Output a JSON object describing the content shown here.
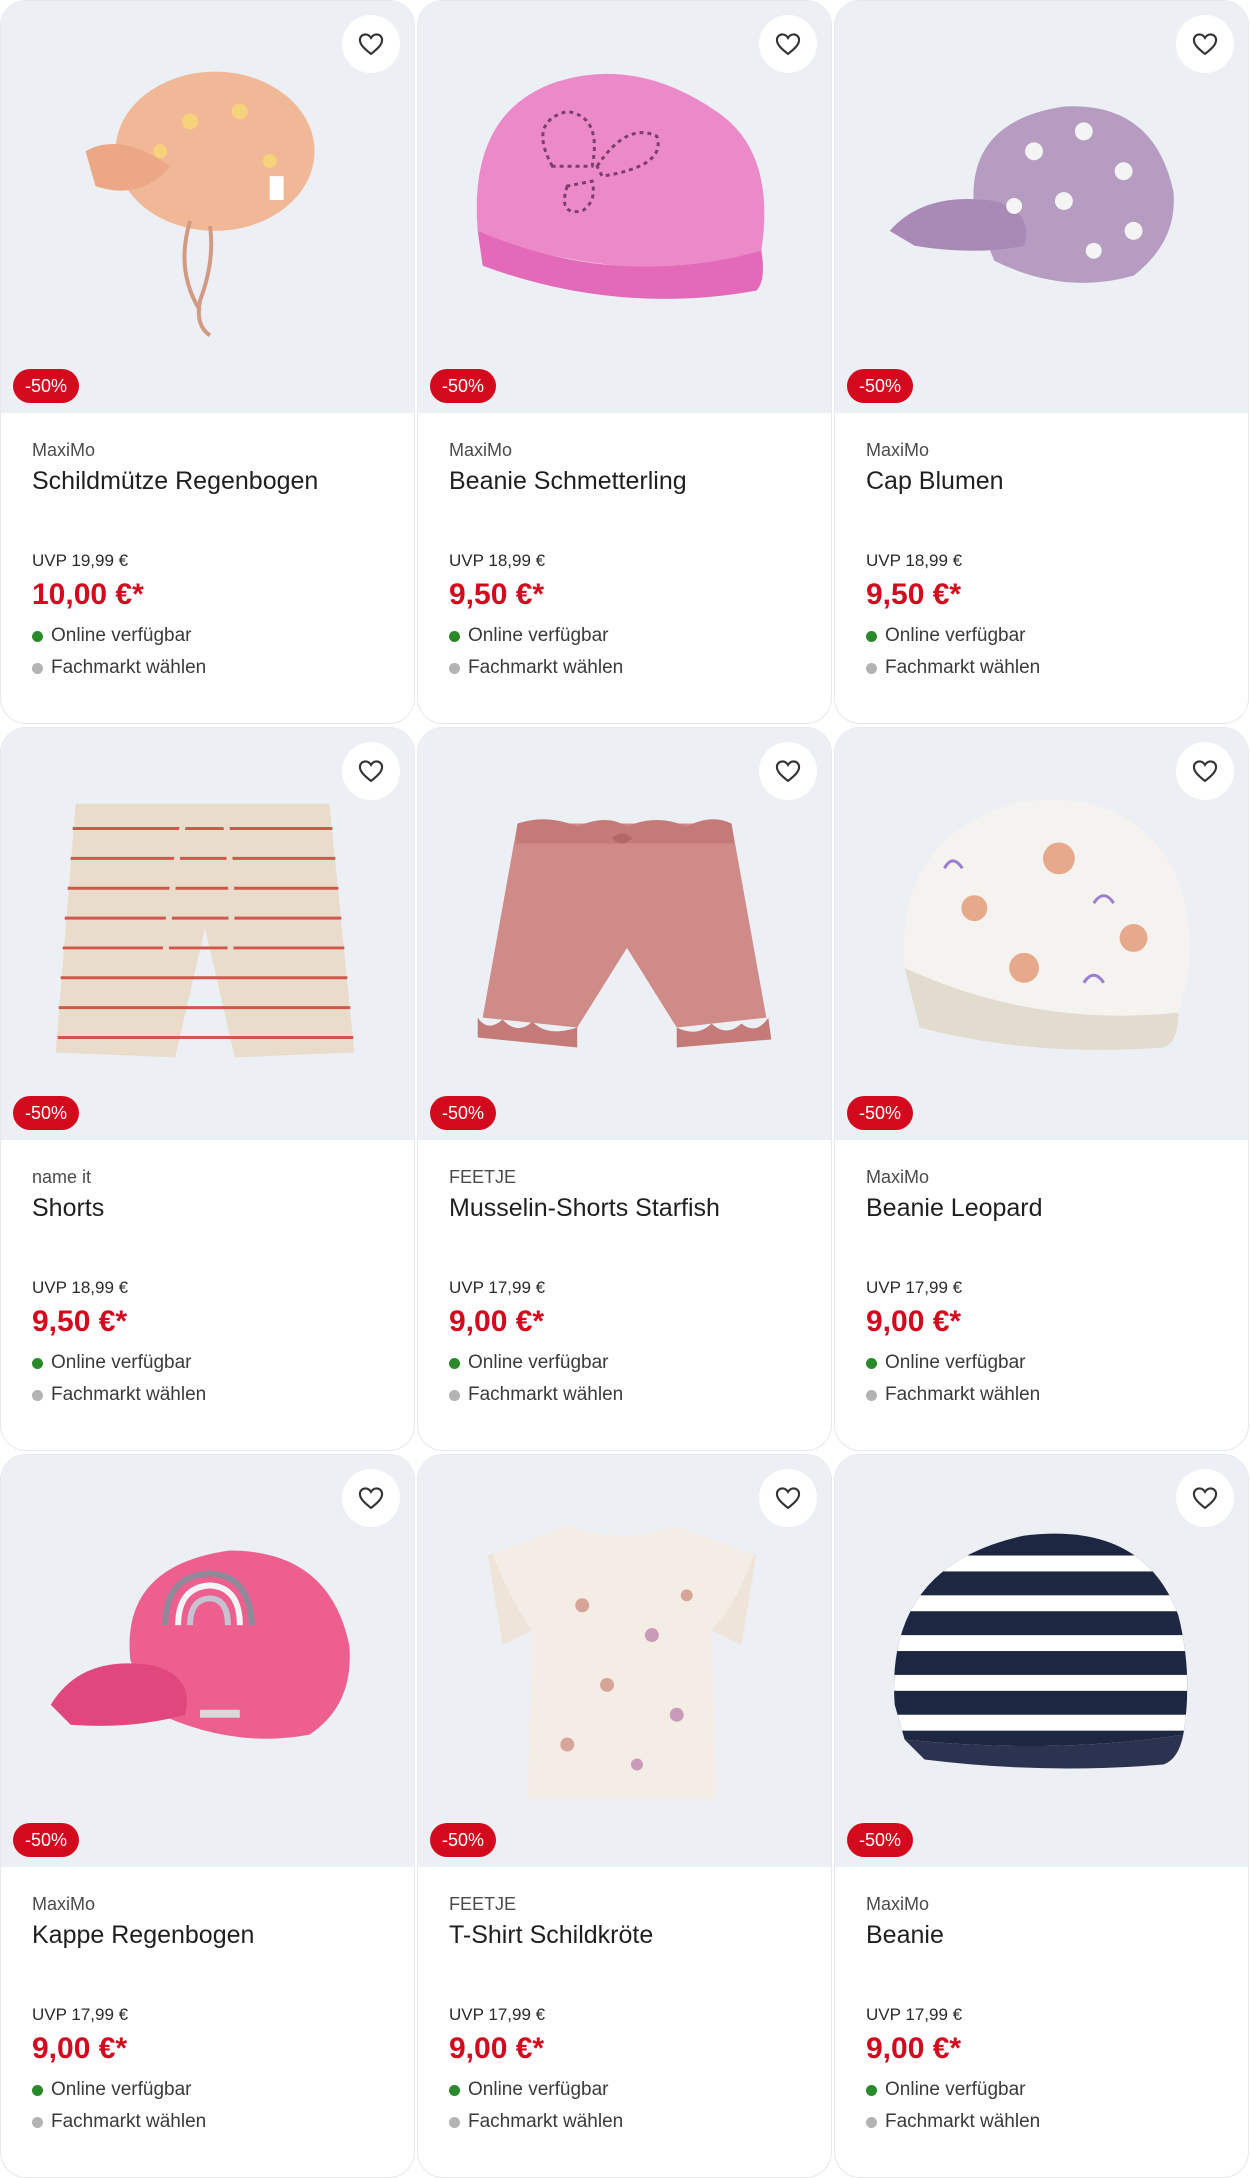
{
  "colors": {
    "badge_bg": "#d3091e",
    "price": "#d3091e",
    "online_dot": "#2a8a2a",
    "store_dot": "#b3b3b3",
    "image_bg": "#eceff4"
  },
  "icons": {
    "favorite": "heart-outline-icon"
  },
  "products": [
    {
      "badge": "-50%",
      "brand": "MaxiMo",
      "title": "Schildmütze Regenbogen",
      "uvp": "UVP 19,99 €",
      "price": "10,00 €*",
      "online": "Online verfügbar",
      "store": "Fachmarkt wählen"
    },
    {
      "badge": "-50%",
      "brand": "MaxiMo",
      "title": "Beanie Schmetterling",
      "uvp": "UVP 18,99 €",
      "price": "9,50 €*",
      "online": "Online verfügbar",
      "store": "Fachmarkt wählen"
    },
    {
      "badge": "-50%",
      "brand": "MaxiMo",
      "title": "Cap Blumen",
      "uvp": "UVP 18,99 €",
      "price": "9,50 €*",
      "online": "Online verfügbar",
      "store": "Fachmarkt wählen"
    },
    {
      "badge": "-50%",
      "brand": "name it",
      "title": "Shorts",
      "uvp": "UVP 18,99 €",
      "price": "9,50 €*",
      "online": "Online verfügbar",
      "store": "Fachmarkt wählen"
    },
    {
      "badge": "-50%",
      "brand": "FEETJE",
      "title": "Musselin-Shorts Starfish",
      "uvp": "UVP 17,99 €",
      "price": "9,00 €*",
      "online": "Online verfügbar",
      "store": "Fachmarkt wählen"
    },
    {
      "badge": "-50%",
      "brand": "MaxiMo",
      "title": "Beanie Leopard",
      "uvp": "UVP 17,99 €",
      "price": "9,00 €*",
      "online": "Online verfügbar",
      "store": "Fachmarkt wählen"
    },
    {
      "badge": "-50%",
      "brand": "MaxiMo",
      "title": "Kappe Regenbogen",
      "uvp": "UVP 17,99 €",
      "price": "9,00 €*",
      "online": "Online verfügbar",
      "store": "Fachmarkt wählen"
    },
    {
      "badge": "-50%",
      "brand": "FEETJE",
      "title": "T-Shirt Schildkröte",
      "uvp": "UVP 17,99 €",
      "price": "9,00 €*",
      "online": "Online verfügbar",
      "store": "Fachmarkt wählen"
    },
    {
      "badge": "-50%",
      "brand": "MaxiMo",
      "title": "Beanie",
      "uvp": "UVP 17,99 €",
      "price": "9,00 €*",
      "online": "Online verfügbar",
      "store": "Fachmarkt wählen"
    }
  ]
}
